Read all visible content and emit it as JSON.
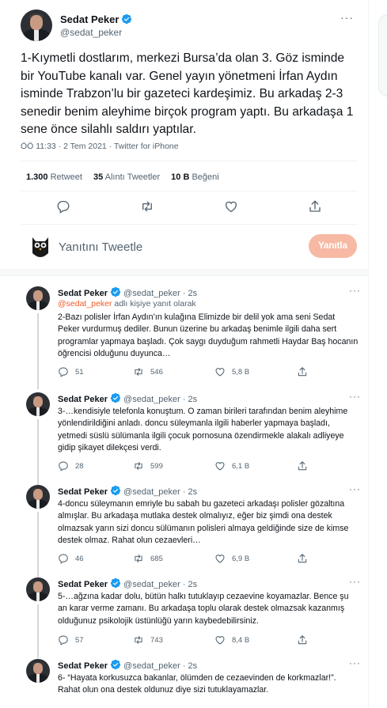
{
  "main_tweet": {
    "author_name": "Sedat Peker",
    "author_handle": "@sedat_peker",
    "menu_glyph": "···",
    "text": "1-Kıymetli dostlarım, merkezi Bursa’da olan 3. Göz isminde bir YouTube kanalı var. Genel yayın yönetmeni İrfan Aydın isminde Trabzon’lu bir gazeteci kardeşimiz. Bu arkadaş 2-3 senedir benim aleyhime birçok program yaptı. Bu arkadaşa 1 sene önce silahlı saldırı yaptılar.",
    "timestamp": "ÖÖ 11:33 · 2 Tem 2021 · Twitter for iPhone",
    "retweets_count": "1.300",
    "retweets_label": "Retweet",
    "quotes_count": "35",
    "quotes_label": "Alıntı Tweetler",
    "likes_count": "10 B",
    "likes_label": "Beğeni"
  },
  "reply_composer": {
    "placeholder": "Yanıtını Tweetle",
    "button_label": "Yanıtla"
  },
  "replies": [
    {
      "name": "Sedat Peker",
      "handle": "@sedat_peker",
      "time": "· 2s",
      "replying_mention": "@sedat_peker",
      "replying_suffix": " adlı kişiye yanıt olarak",
      "text": "2-Bazı polisler İrfan Aydın’ın kulağına Elimizde bir delil yok ama seni Sedat Peker vurdurmuş dediler. Bunun üzerine bu arkadaş benimle ilgili daha sert programlar yapmaya başladı. Çok saygı duyduğum rahmetli Haydar Baş hocanın öğrencisi olduğunu duyunca…",
      "replies": "51",
      "retweets": "546",
      "likes": "5,8 B"
    },
    {
      "name": "Sedat Peker",
      "handle": "@sedat_peker",
      "time": "· 2s",
      "text": "3-…kendisiyle telefonla konuştum. O zaman birileri tarafından benim aleyhime yönlendirildiğini anladı. doncu süleymanla ilgili haberler yapmaya başladı, yetmedi süslü sülümanla ilgili çocuk pornosuna özendirmekle alakalı adliyeye gidip şikayet dilekçesi verdi.",
      "replies": "28",
      "retweets": "599",
      "likes": "6,1 B"
    },
    {
      "name": "Sedat Peker",
      "handle": "@sedat_peker",
      "time": "· 2s",
      "text": "4-doncu süleymanın emriyle bu sabah bu gazeteci arkadaşı polisler gözaltına almışlar. Bu arkadaşa mutlaka destek olmalıyız, eğer biz şimdi ona destek olmazsak yarın sizi doncu sülümanın polisleri almaya geldiğinde size de kimse destek olmaz. Rahat olun cezaevleri…",
      "replies": "46",
      "retweets": "685",
      "likes": "6,9 B"
    },
    {
      "name": "Sedat Peker",
      "handle": "@sedat_peker",
      "time": "· 2s",
      "text": "5-…ağzına kadar dolu, bütün halkı tutuklayıp cezaevine koyamazlar. Bence şu an karar verme zamanı. Bu arkadaşa toplu olarak destek olmazsak kazanmış olduğunuz psikolojik üstünlüğü yarın kaybedebilirsiniz.",
      "replies": "57",
      "retweets": "743",
      "likes": "8,4 B"
    },
    {
      "name": "Sedat Peker",
      "handle": "@sedat_peker",
      "time": "· 2s",
      "text": "6- “Hayata korkusuzca bakanlar, ölümden de cezaevinden de korkmazlar!”. Rahat olun ona destek oldunuz diye sizi tutuklayamazlar."
    }
  ],
  "colors": {
    "verified": "#1d9bf0",
    "mention": "#f05a28",
    "reply_button": "#f7b9a4",
    "secondary_text": "#536471"
  },
  "icons": [
    "verified-badge-icon",
    "reply-icon",
    "retweet-icon",
    "like-icon",
    "share-icon",
    "owl-avatar-icon",
    "more-icon"
  ]
}
